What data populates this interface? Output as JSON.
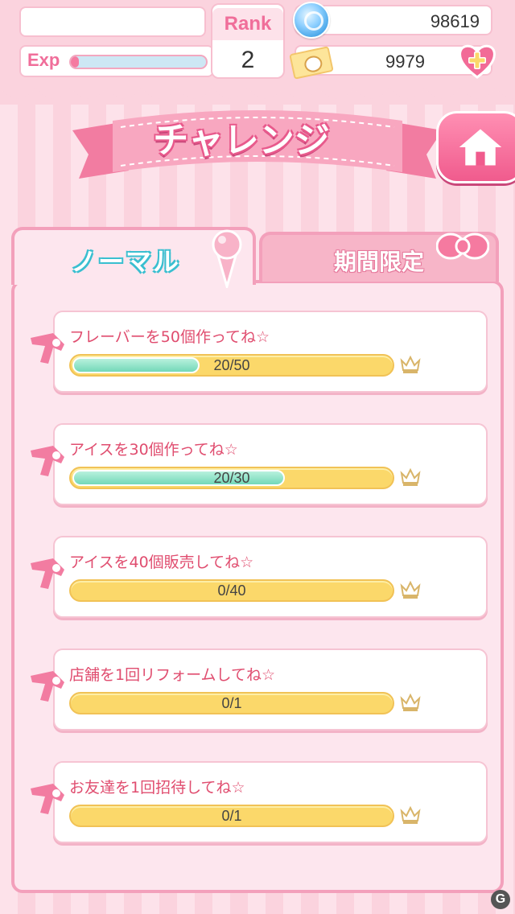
{
  "header": {
    "player_name": "",
    "exp_label": "Exp",
    "exp_progress": 0.02,
    "rank_label": "Rank",
    "rank_value": "2",
    "gems": "98619",
    "tickets": "9979"
  },
  "title": "チャレンジ",
  "tabs": [
    {
      "label": "ノーマル",
      "selected": true
    },
    {
      "label": "期間限定",
      "selected": false
    }
  ],
  "challenges": [
    {
      "title": "フレーバーを50個作ってね☆",
      "current": 20,
      "total": 50,
      "count": "20/50"
    },
    {
      "title": "アイスを30個作ってね☆",
      "current": 20,
      "total": 30,
      "count": "20/30"
    },
    {
      "title": "アイスを40個販売してね☆",
      "current": 0,
      "total": 40,
      "count": "0/40"
    },
    {
      "title": "店舗を1回リフォームしてね☆",
      "current": 0,
      "total": 1,
      "count": "0/1"
    },
    {
      "title": "お友達を1回招待してね☆",
      "current": 0,
      "total": 1,
      "count": "0/1"
    }
  ],
  "colors": {
    "accent": "#f06e9a",
    "progress_fill": "#73d8b8",
    "progress_track": "#fbd86a",
    "title_text": "#e04d6f"
  },
  "icons": {
    "gem": "gem-icon",
    "ticket": "ticket-icon",
    "plus": "plus-heart-icon",
    "home": "home-icon",
    "crown": "crown-icon",
    "bow": "bow-icon",
    "icecream": "icecream-icon",
    "tag": "ribbon-tag-icon"
  },
  "watermark": "G"
}
